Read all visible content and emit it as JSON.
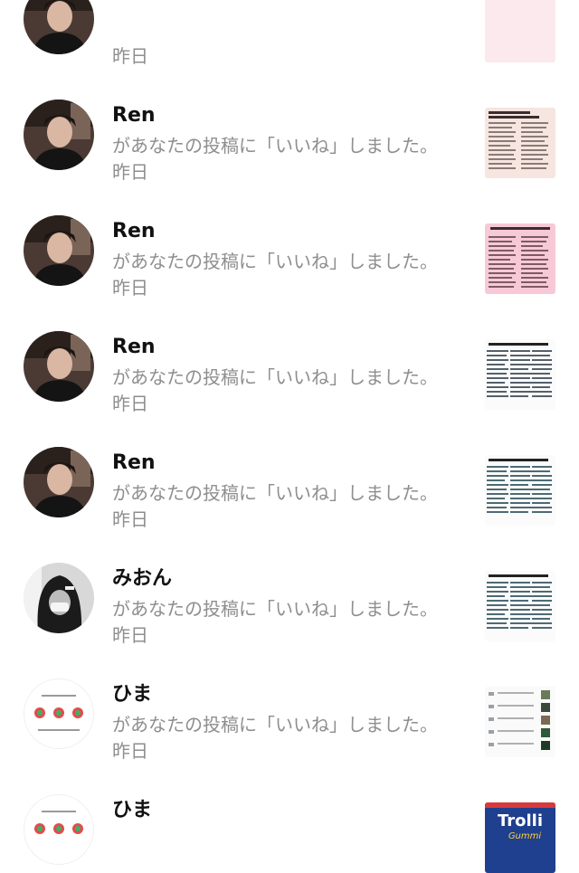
{
  "notifications": [
    {
      "name": "",
      "message": "",
      "time": "昨日",
      "avatar": "avatar-person",
      "thumb": "thumb-pink-list"
    },
    {
      "name": "Ren",
      "message": "があなたの投稿に「いいね」しました。",
      "time": "昨日",
      "avatar": "avatar-person",
      "thumb": "thumb-beige-list"
    },
    {
      "name": "Ren",
      "message": "があなたの投稿に「いいね」しました。",
      "time": "昨日",
      "avatar": "avatar-person",
      "thumb": "thumb-pink-list"
    },
    {
      "name": "Ren",
      "message": "があなたの投稿に「いいね」しました。",
      "time": "昨日",
      "avatar": "avatar-person",
      "thumb": "thumb-white-list"
    },
    {
      "name": "Ren",
      "message": "があなたの投稿に「いいね」しました。",
      "time": "昨日",
      "avatar": "avatar-person",
      "thumb": "thumb-white-list"
    },
    {
      "name": "みおん",
      "message": "があなたの投稿に「いいね」しました。",
      "time": "昨日",
      "avatar": "avatar-hoodie",
      "thumb": "thumb-white-list"
    },
    {
      "name": "ひま",
      "message": "があなたの投稿に「いいね」しました。",
      "time": "昨日",
      "avatar": "avatar-candy",
      "thumb": "thumb-app-list"
    },
    {
      "name": "ひま",
      "message": "",
      "time": "",
      "avatar": "avatar-candy",
      "thumb": "thumb-trolli"
    }
  ],
  "thumb_texts": {
    "trolli": "Trolli",
    "gummi": "Gummi"
  },
  "colors": {
    "name_text": "#111111",
    "secondary_text": "#8e8e8e",
    "background": "#ffffff"
  }
}
